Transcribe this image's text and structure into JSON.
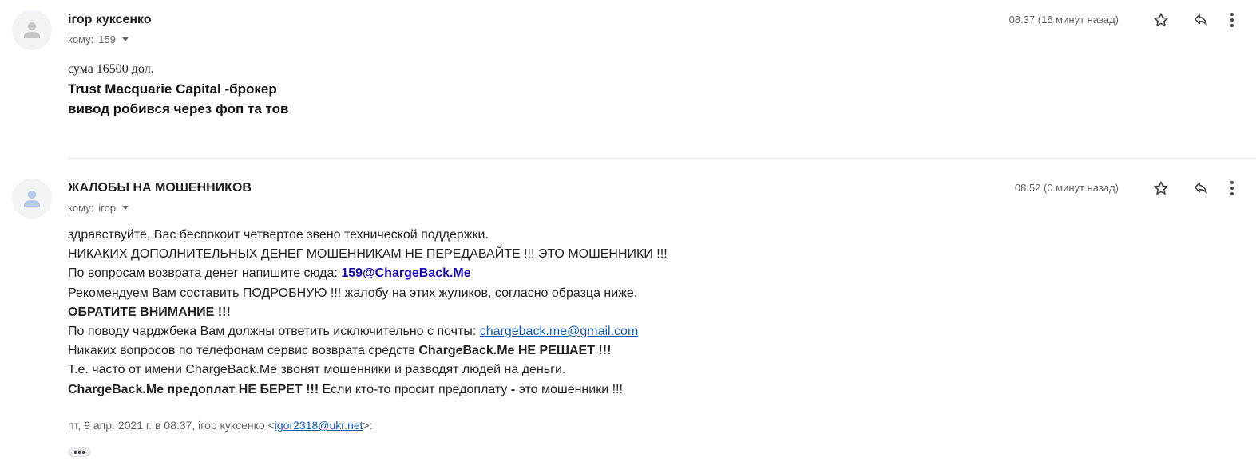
{
  "messages": [
    {
      "sender": "ігор куксенко",
      "recipient_prefix": "кому:",
      "recipient": "159",
      "time": "08:37 (16 минут назад)",
      "body": {
        "line1": "сума 16500 дол.",
        "line2": "Trust Macquarie Capital -брокер",
        "line3": "вивод робився через фоп та тов"
      }
    },
    {
      "sender": "ЖАЛОБЫ НА МОШЕННИКОВ",
      "recipient_prefix": "кому:",
      "recipient": "ігор",
      "time": "08:52 (0 минут назад)",
      "body": {
        "line1": "здравствуйте, Вас беспокоит четвертое звено технической поддержки.",
        "line2": "НИКАКИХ ДОПОЛНИТЕЛЬНЫХ ДЕНЕГ МОШЕННИКАМ НЕ ПЕРЕДАВАЙТЕ !!! ЭТО МОШЕННИКИ !!!",
        "line3_text": "По вопросам возврата денег напишите сюда: ",
        "line3_email": "159@ChargeBack.Me",
        "line4": "Рекомендуем Вам составить ПОДРОБНУЮ !!! жалобу на этих жуликов, согласно образца ниже.",
        "line5": "ОБРАТИТЕ ВНИМАНИЕ !!!",
        "line6_text": "По поводу чарджбека Вам должны ответить исключительно с почты: ",
        "line6_email": "chargeback.me@gmail.com",
        "line7_text": "Никаких вопросов по телефонам сервис возврата средств ",
        "line7_bold": "ChargeBack.Me НЕ РЕШАЕТ !!!",
        "line8": "Т.е. часто от имени ChargeBack.Me звонят мошенники и разводят людей на деньги.",
        "line9_bold": "ChargeBack.Me предоплат НЕ БЕРЕТ !!!",
        "line9_text": " Если кто-то просит предоплату ",
        "line9_dash": "-",
        "line9_end": " это мошенники !!!"
      },
      "quote": {
        "prefix": "пт, 9 апр. 2021 г. в 08:37, ігор куксенко <",
        "email": "igor2318@ukr.net",
        "suffix": ">:"
      }
    }
  ],
  "icons": {
    "avatar": "person-avatar-icon",
    "star": "star-icon",
    "reply": "reply-icon",
    "more": "more-vert-icon",
    "expand": "chevron-down-icon",
    "trimmed": "show-trimmed-content-icon"
  },
  "colors": {
    "link": "#1a5cab",
    "email_highlight": "#1a0dab",
    "muted": "#5f6368"
  }
}
